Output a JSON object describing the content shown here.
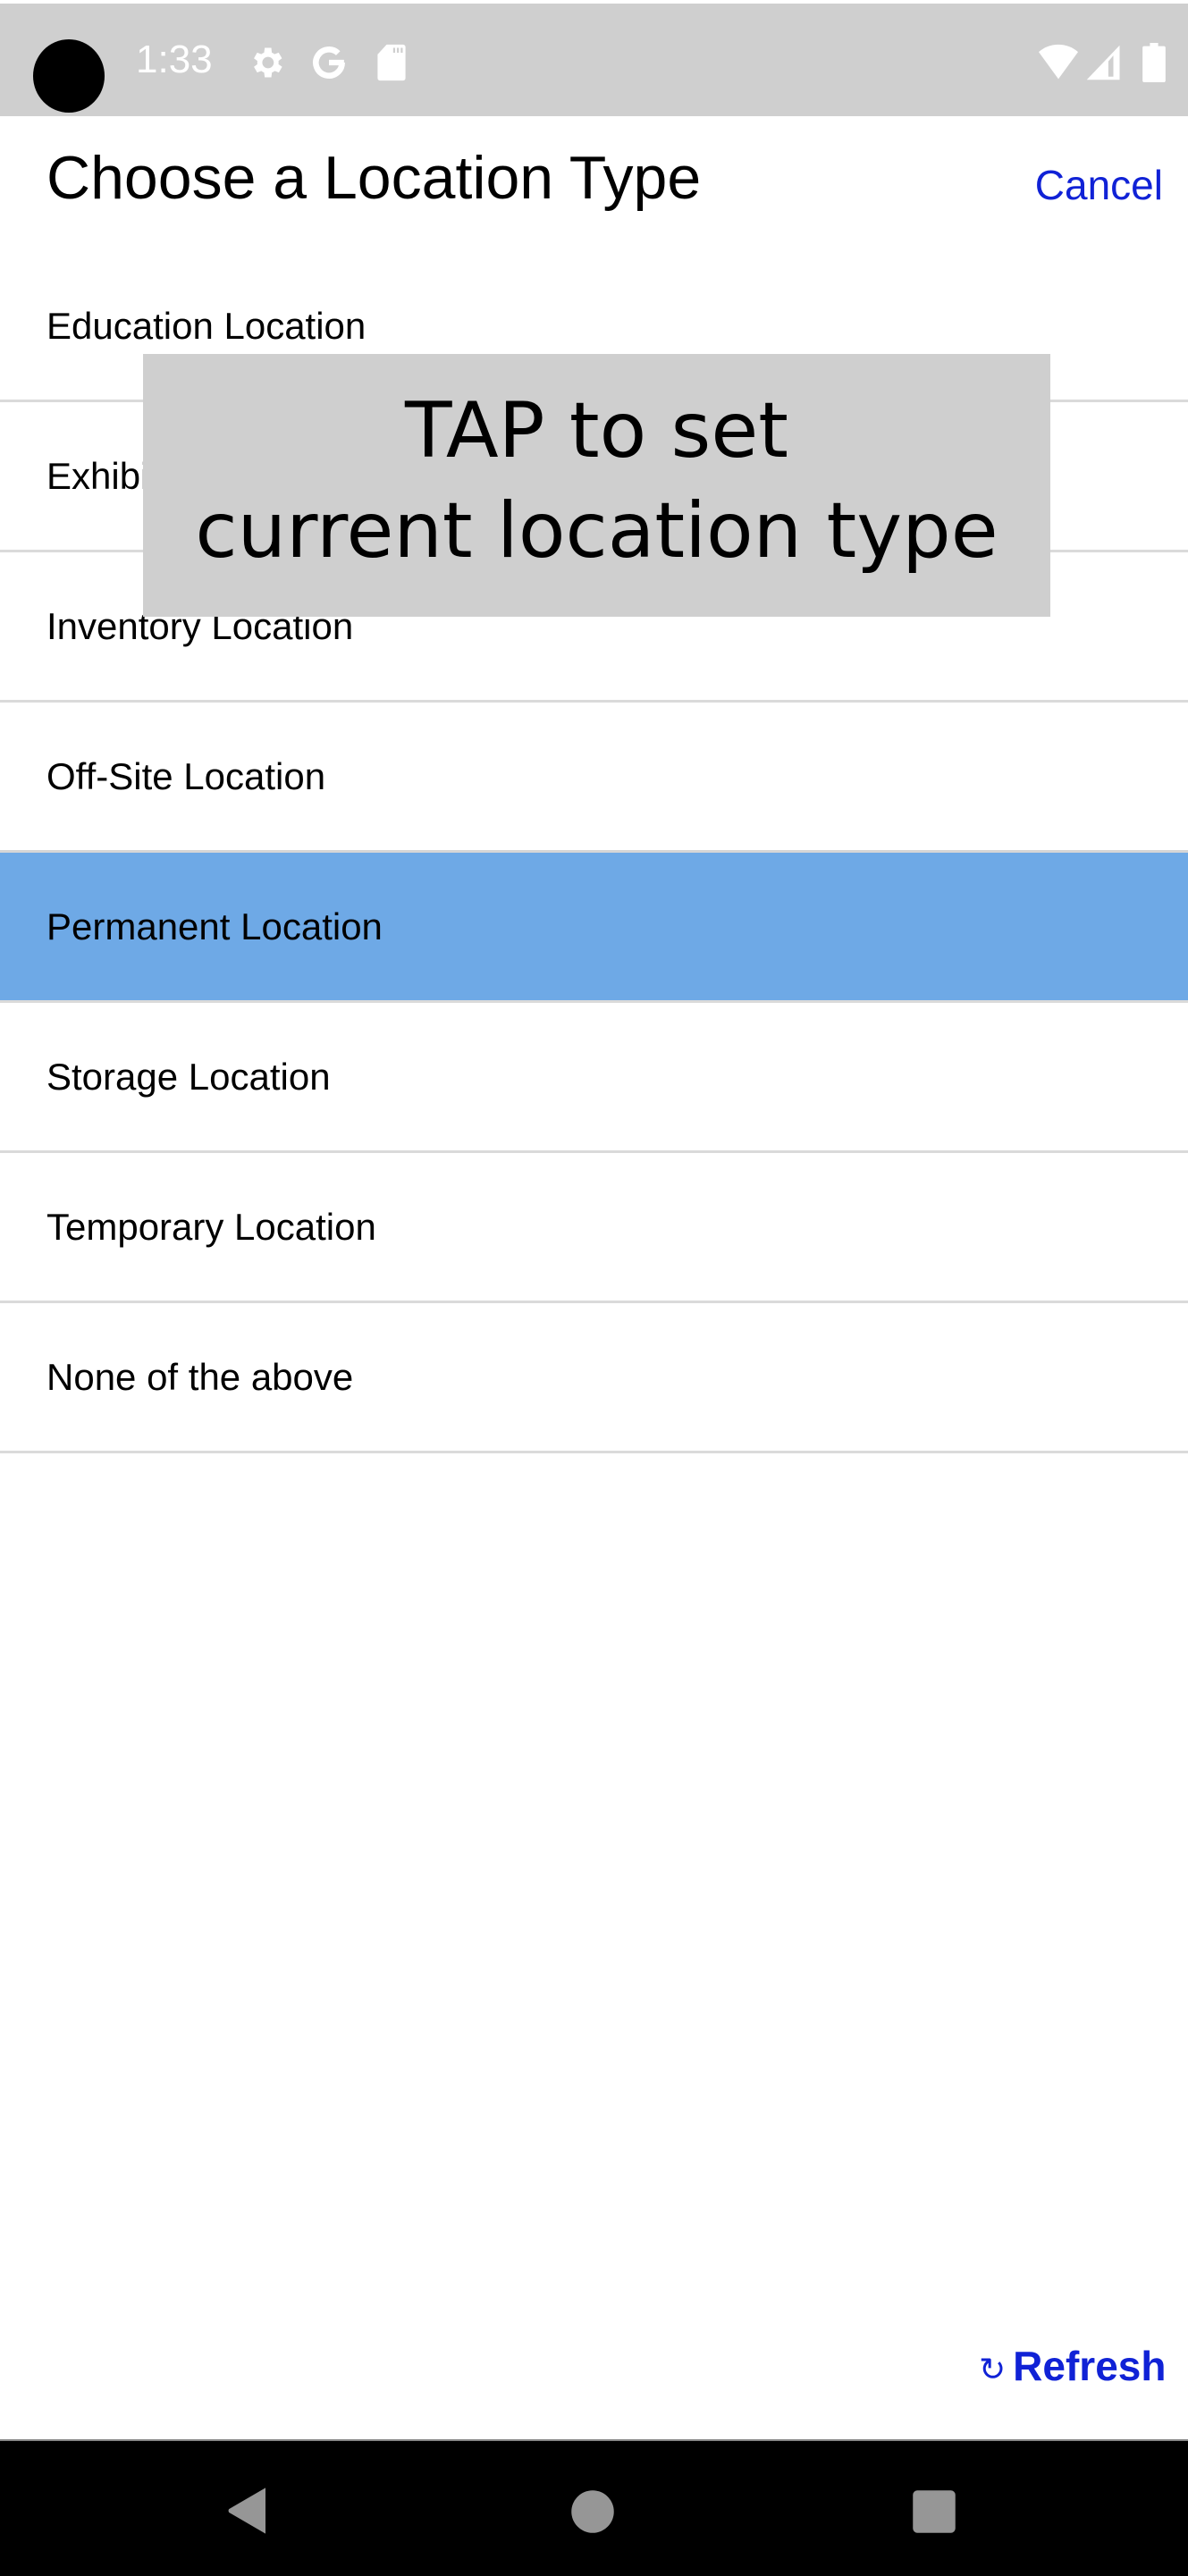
{
  "status_bar": {
    "time": "1:33",
    "left_icons": [
      "gear-icon",
      "google-icon",
      "sd-card-icon"
    ],
    "right_icons": [
      "wifi-icon",
      "cell-signal-icon",
      "battery-icon"
    ]
  },
  "header": {
    "title": "Choose a Location Type",
    "cancel_label": "Cancel"
  },
  "list": {
    "items": [
      {
        "label": "Education Location",
        "selected": false
      },
      {
        "label": "Exhibit Location",
        "selected": false
      },
      {
        "label": "Inventory Location",
        "selected": false
      },
      {
        "label": "Off-Site Location",
        "selected": false
      },
      {
        "label": "Permanent Location",
        "selected": true
      },
      {
        "label": "Storage Location",
        "selected": false
      },
      {
        "label": "Temporary Location",
        "selected": false
      },
      {
        "label": "None of the above",
        "selected": false
      }
    ],
    "selected_color": "#6ea9e6"
  },
  "overlay": {
    "line1": "TAP to set",
    "line2": "current location type"
  },
  "footer": {
    "refresh_icon": "↻",
    "refresh_label": "Refresh",
    "link_color": "#1022d6"
  },
  "nav_bar": {
    "buttons": [
      "back-icon",
      "home-icon",
      "recents-icon"
    ]
  }
}
